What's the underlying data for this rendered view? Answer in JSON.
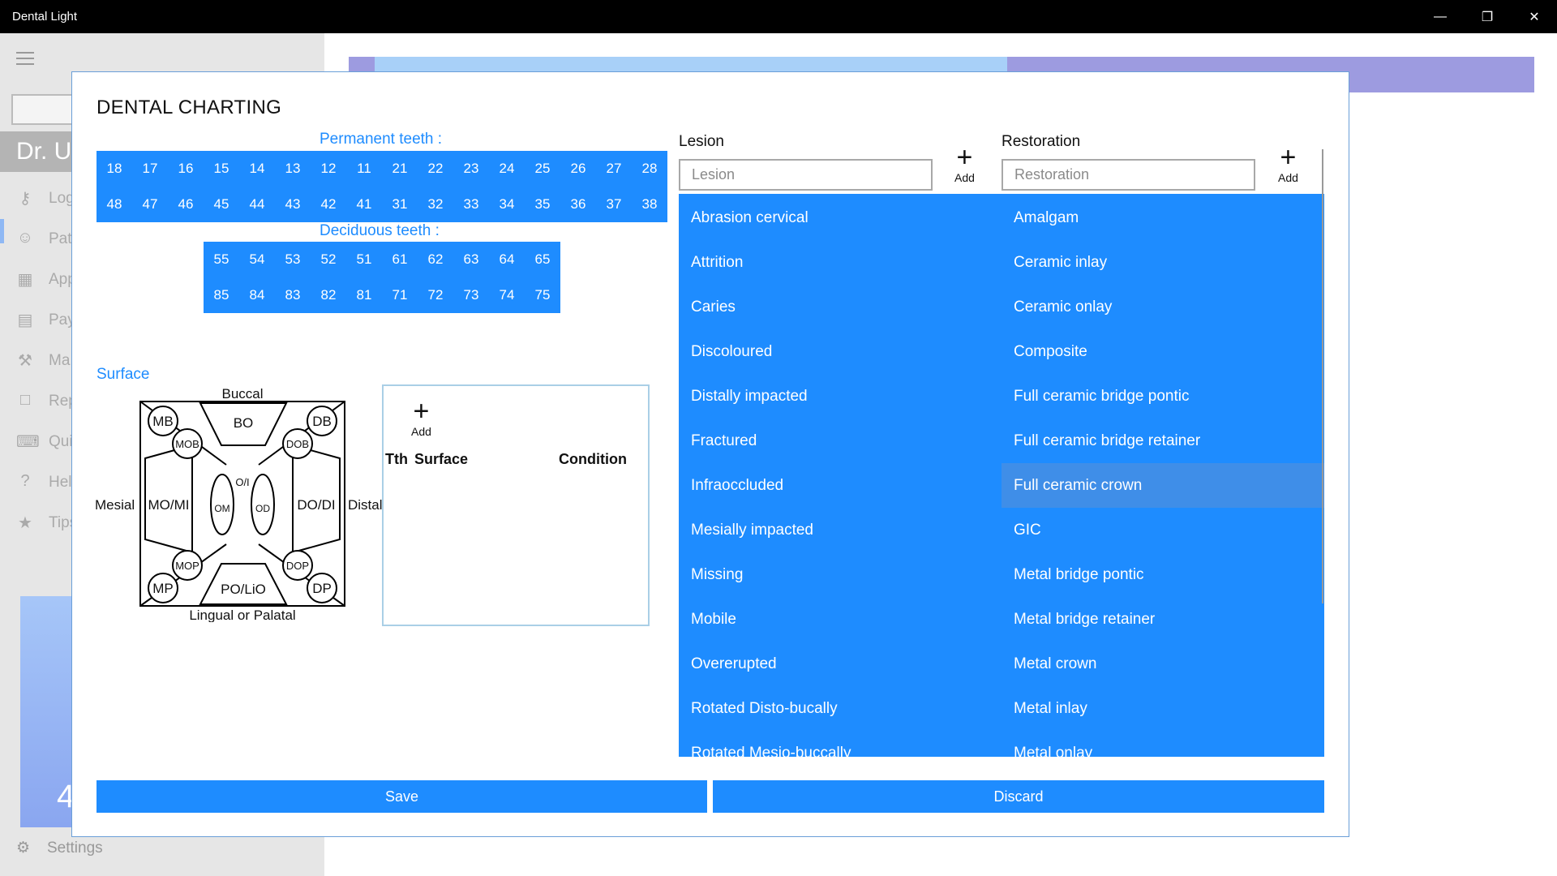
{
  "window": {
    "title": "Dental Light",
    "controls": {
      "minimize": "—",
      "maximize": "❐",
      "close": "✕"
    }
  },
  "background_app": {
    "user_name": "Dr. U",
    "nav": [
      {
        "icon": "key-icon",
        "glyph": "⚷",
        "label": "Log"
      },
      {
        "icon": "user-icon",
        "glyph": "☺",
        "label": "Pati"
      },
      {
        "icon": "calendar-icon",
        "glyph": "▦",
        "label": "App"
      },
      {
        "icon": "payment-icon",
        "glyph": "▤",
        "label": "Pay"
      },
      {
        "icon": "wrench-icon",
        "glyph": "⚒",
        "label": "Ma"
      },
      {
        "icon": "document-icon",
        "glyph": "□",
        "label": "Rep"
      },
      {
        "icon": "keyboard-icon",
        "glyph": "⌨",
        "label": "Qui"
      },
      {
        "icon": "help-icon",
        "glyph": "?",
        "label": "Hel"
      },
      {
        "icon": "star-icon",
        "glyph": "★",
        "label": "Tips"
      }
    ],
    "tile_number": "4",
    "settings_label": "Settings",
    "settings_glyph": "⚙"
  },
  "dialog": {
    "title": "DENTAL CHARTING",
    "permanent_label": "Permanent teeth :",
    "permanent_rows": [
      [
        "18",
        "17",
        "16",
        "15",
        "14",
        "13",
        "12",
        "11",
        "21",
        "22",
        "23",
        "24",
        "25",
        "26",
        "27",
        "28"
      ],
      [
        "48",
        "47",
        "46",
        "45",
        "44",
        "43",
        "42",
        "41",
        "31",
        "32",
        "33",
        "34",
        "35",
        "36",
        "37",
        "38"
      ]
    ],
    "deciduous_label": "Deciduous teeth :",
    "deciduous_rows": [
      [
        "55",
        "54",
        "53",
        "52",
        "51",
        "61",
        "62",
        "63",
        "64",
        "65"
      ],
      [
        "85",
        "84",
        "83",
        "82",
        "81",
        "71",
        "72",
        "73",
        "74",
        "75"
      ]
    ],
    "surface": {
      "label": "Surface",
      "buccal": "Buccal",
      "mesial": "Mesial",
      "distal": "Distal",
      "lingual": "Lingual or Palatal",
      "regions": {
        "mb": "MB",
        "bo": "BO",
        "db": "DB",
        "mob": "MOB",
        "dob": "DOB",
        "mo_mi": "MO/MI",
        "om": "OM",
        "oi": "O/I",
        "od": "OD",
        "do_di": "DO/DI",
        "mop": "MOP",
        "dop": "DOP",
        "mp": "MP",
        "po_lio": "PO/LiO",
        "dp": "DP"
      }
    },
    "surface_table": {
      "add_label": "Add",
      "headers": {
        "tooth": "Tth",
        "surface": "Surface",
        "condition": "Condition"
      }
    },
    "lesion": {
      "label": "Lesion",
      "placeholder": "Lesion",
      "add_label": "Add",
      "items": [
        "Abrasion cervical",
        "Attrition",
        "Caries",
        "Discoloured",
        "Distally impacted",
        "Fractured",
        "Infraoccluded",
        "Mesially impacted",
        "Missing",
        "Mobile",
        "Overerupted",
        "Rotated Disto-bucally",
        "Rotated Mesio-buccally"
      ]
    },
    "restoration": {
      "label": "Restoration",
      "placeholder": "Restoration",
      "add_label": "Add",
      "selected": "Full ceramic crown",
      "items": [
        "Amalgam",
        "Ceramic inlay",
        "Ceramic onlay",
        "Composite",
        "Full ceramic bridge pontic",
        "Full ceramic bridge retainer",
        "Full ceramic crown",
        "GIC",
        "Metal bridge pontic",
        "Metal bridge retainer",
        "Metal crown",
        "Metal inlay",
        "Metal onlay"
      ]
    },
    "buttons": {
      "save": "Save",
      "discard": "Discard"
    }
  },
  "colors": {
    "accent": "#1e8cff",
    "selected": "#3f8ee8",
    "titlebar": "#000000"
  }
}
